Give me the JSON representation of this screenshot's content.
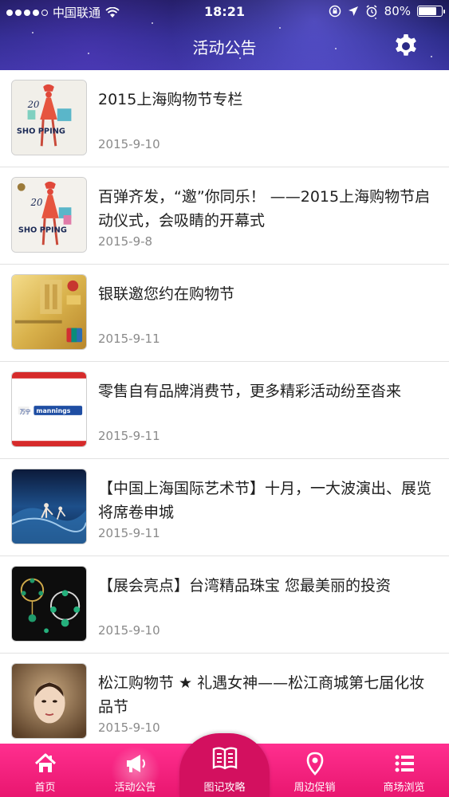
{
  "status_bar": {
    "carrier": "中国联通",
    "time": "18:21",
    "battery": "80%",
    "battery_level": 0.8
  },
  "navbar": {
    "title": "活动公告",
    "settings_icon": "gear-icon"
  },
  "announcements": [
    {
      "title": "2015上海购物节专栏",
      "date": "2015-9-10",
      "thumb": "shopping-festival-poster"
    },
    {
      "title": "百弹齐发，“邀”你同乐！ ——2015上海购物节启动仪式，会吸睛的开幕式",
      "date": "2015-9-8",
      "thumb": "shopping-festival-poster"
    },
    {
      "title": "银联邀您约在购物节",
      "date": "2015-9-11",
      "thumb": "unionpay-card"
    },
    {
      "title": "零售自有品牌消费节，更多精彩活动纷至沓来",
      "date": "2015-9-11",
      "thumb": "retail-brands-banner"
    },
    {
      "title": "【中国上海国际艺术节】十月，一大波演出、展览将席卷申城",
      "date": "2015-9-11",
      "thumb": "art-festival-dance"
    },
    {
      "title": "【展会亮点】台湾精品珠宝  您最美丽的投资",
      "date": "2015-9-10",
      "thumb": "jewelry-photo"
    },
    {
      "title": "松江购物节 ★ 礼遇女神——松江商城第七届化妆品节",
      "date": "2015-9-10",
      "thumb": "cosmetics-model"
    }
  ],
  "thumb_text": {
    "shopping_poster_year": "20",
    "shopping_poster_word": "SHO PPING",
    "retail_brand": "mannings"
  },
  "tabbar": {
    "tabs": [
      {
        "label": "首页",
        "icon": "home-icon"
      },
      {
        "label": "活动公告",
        "icon": "megaphone-icon"
      },
      {
        "label": "图记攻略",
        "icon": "book-icon"
      },
      {
        "label": "周边促销",
        "icon": "location-pin-icon"
      },
      {
        "label": "商场浏览",
        "icon": "list-icon"
      }
    ],
    "active_index": 1,
    "color": "#ee1a77"
  }
}
